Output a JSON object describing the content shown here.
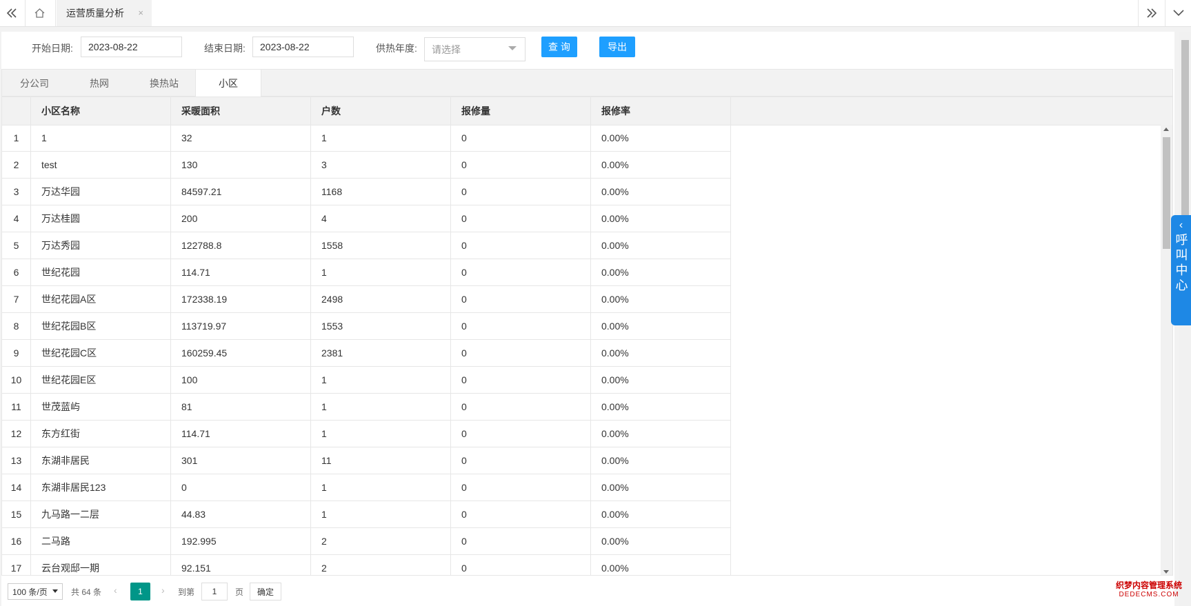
{
  "topbar": {
    "active_tab": "运营质量分析",
    "close_glyph": "×"
  },
  "filters": {
    "start_label": "开始日期:",
    "start_value": "2023-08-22",
    "end_label": "结束日期:",
    "end_value": "2023-08-22",
    "year_label": "供热年度:",
    "year_placeholder": "请选择",
    "query_button": "查 询",
    "export_button": "导出"
  },
  "tabs": [
    "分公司",
    "热网",
    "换热站",
    "小区"
  ],
  "active_tab_index": 3,
  "table": {
    "headers": [
      "小区名称",
      "采暖面积",
      "户数",
      "报修量",
      "报修率"
    ],
    "rows": [
      {
        "no": "1",
        "name": "1",
        "area": "32",
        "households": "1",
        "repairs": "0",
        "rate": "0.00%"
      },
      {
        "no": "2",
        "name": "test",
        "area": "130",
        "households": "3",
        "repairs": "0",
        "rate": "0.00%"
      },
      {
        "no": "3",
        "name": "万达华园",
        "area": "84597.21",
        "households": "1168",
        "repairs": "0",
        "rate": "0.00%"
      },
      {
        "no": "4",
        "name": "万达桂圆",
        "area": "200",
        "households": "4",
        "repairs": "0",
        "rate": "0.00%"
      },
      {
        "no": "5",
        "name": "万达秀园",
        "area": "122788.8",
        "households": "1558",
        "repairs": "0",
        "rate": "0.00%"
      },
      {
        "no": "6",
        "name": "世纪花园",
        "area": "114.71",
        "households": "1",
        "repairs": "0",
        "rate": "0.00%"
      },
      {
        "no": "7",
        "name": "世纪花园A区",
        "area": "172338.19",
        "households": "2498",
        "repairs": "0",
        "rate": "0.00%"
      },
      {
        "no": "8",
        "name": "世纪花园B区",
        "area": "113719.97",
        "households": "1553",
        "repairs": "0",
        "rate": "0.00%"
      },
      {
        "no": "9",
        "name": "世纪花园C区",
        "area": "160259.45",
        "households": "2381",
        "repairs": "0",
        "rate": "0.00%"
      },
      {
        "no": "10",
        "name": "世纪花园E区",
        "area": "100",
        "households": "1",
        "repairs": "0",
        "rate": "0.00%"
      },
      {
        "no": "11",
        "name": "世茂蓝屿",
        "area": "81",
        "households": "1",
        "repairs": "0",
        "rate": "0.00%"
      },
      {
        "no": "12",
        "name": "东方红街",
        "area": "114.71",
        "households": "1",
        "repairs": "0",
        "rate": "0.00%"
      },
      {
        "no": "13",
        "name": "东湖非居民",
        "area": "301",
        "households": "11",
        "repairs": "0",
        "rate": "0.00%"
      },
      {
        "no": "14",
        "name": "东湖非居民123",
        "area": "0",
        "households": "1",
        "repairs": "0",
        "rate": "0.00%"
      },
      {
        "no": "15",
        "name": "九马路一二层",
        "area": "44.83",
        "households": "1",
        "repairs": "0",
        "rate": "0.00%"
      },
      {
        "no": "16",
        "name": "二马路",
        "area": "192.995",
        "households": "2",
        "repairs": "0",
        "rate": "0.00%"
      },
      {
        "no": "17",
        "name": "云台观邸一期",
        "area": "92.151",
        "households": "2",
        "repairs": "0",
        "rate": "0.00%"
      }
    ]
  },
  "pager": {
    "page_size": "100 条/页",
    "total": "共 64 条",
    "current_page": "1",
    "goto_label": "到第",
    "goto_value": "1",
    "page_unit": "页",
    "confirm": "确定"
  },
  "callcenter": {
    "label": "呼叫中心"
  },
  "watermark": {
    "line1": "织梦内容管理系统",
    "line2": "DEDECMS.COM"
  },
  "colors": {
    "primary_button": "#1e9fff",
    "pager_current": "#009688",
    "callcenter": "#1e88e5"
  }
}
